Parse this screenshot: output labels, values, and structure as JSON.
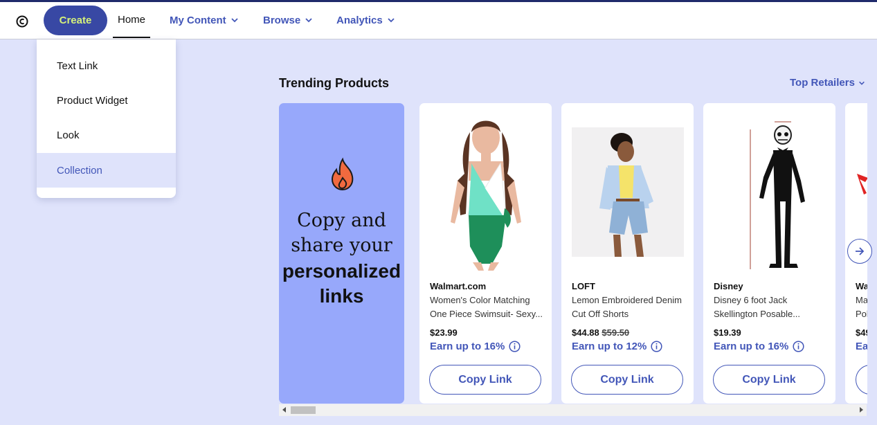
{
  "nav": {
    "create_label": "Create",
    "home_label": "Home",
    "my_content_label": "My Content",
    "browse_label": "Browse",
    "analytics_label": "Analytics"
  },
  "create_menu": {
    "items": [
      {
        "label": "Text Link"
      },
      {
        "label": "Product Widget"
      },
      {
        "label": "Look"
      },
      {
        "label": "Collection"
      }
    ],
    "active": "Collection"
  },
  "section": {
    "title": "Trending Products",
    "filter_label": "Top Retailers"
  },
  "promo": {
    "line1": "Copy and share your",
    "line2": "personalized links"
  },
  "products": [
    {
      "retailer": "Walmart.com",
      "name_line1": "Women's Color Matching",
      "name_line2": "One Piece Swimsuit- Sexy...",
      "price": "$23.99",
      "old_price": "",
      "earn": "Earn up to 16%",
      "copy_label": "Copy Link"
    },
    {
      "retailer": "LOFT",
      "name_line1": "Lemon Embroidered Denim",
      "name_line2": "Cut Off Shorts",
      "price": "$44.88",
      "old_price": "$59.50",
      "earn": "Earn up to 12%",
      "copy_label": "Copy Link"
    },
    {
      "retailer": "Disney",
      "name_line1": "Disney 6 foot Jack",
      "name_line2": "Skellington Posable...",
      "price": "$19.39",
      "old_price": "",
      "earn": "Earn up to 16%",
      "copy_label": "Copy Link"
    }
  ],
  "partial_product": {
    "retailer": "Wa",
    "name_line1": "Ma",
    "name_line2": "Pol",
    "price": "$49",
    "earn": "Ea"
  },
  "colors": {
    "accent": "#4256b8",
    "create_bg": "#3848a4",
    "create_text": "#d6f27a",
    "page_bg": "#dfe3fb",
    "promo_bg": "#97a8fb"
  }
}
